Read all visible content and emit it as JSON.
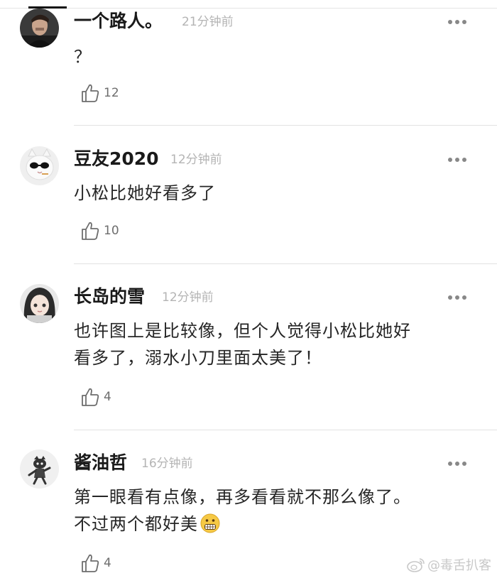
{
  "comments": [
    {
      "username": "一个路人。",
      "time": "21分钟前",
      "text": "？",
      "likes": "12",
      "avatar_icon": "person-portrait-avatar"
    },
    {
      "username": "豆友2020",
      "time": "12分钟前",
      "text": "小松比她好看多了",
      "likes": "10",
      "avatar_icon": "white-cat-sunglasses-avatar"
    },
    {
      "username": "长岛的雪",
      "time": "12分钟前",
      "text_lines": [
        "也许图上是比较像，但个人觉得小松比她好",
        "看多了，溺水小刀里面太美了！"
      ],
      "likes": "4",
      "avatar_icon": "anime-girl-avatar"
    },
    {
      "username": "酱油哲",
      "time": "16分钟前",
      "text_lines": [
        "第一眼看有点像，再多看看就不那么像了。",
        "不过两个都好美"
      ],
      "emoji": "grimacing-face-emoji",
      "likes": "4",
      "avatar_icon": "cartoon-cat-avatar"
    }
  ],
  "icons": {
    "like": "thumbs-up-icon",
    "more": "more-dots-icon"
  },
  "watermark": {
    "text": "@毒舌扒客",
    "icon": "weibo-logo-icon"
  },
  "colors": {
    "time": "#b4b4b4",
    "likes": "#6d6d6d",
    "divider": "#e2e2e2"
  }
}
